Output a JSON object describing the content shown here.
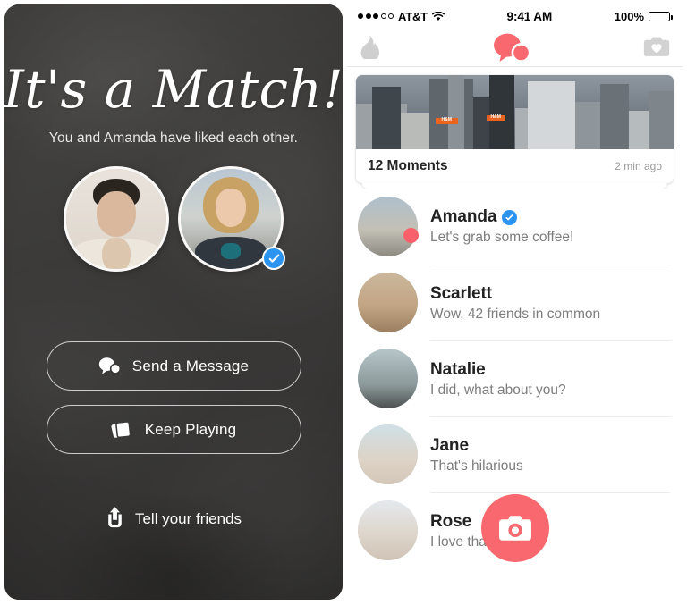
{
  "left_panel": {
    "title": "It's a Match!",
    "subtitle": "You and Amanda have liked each other.",
    "avatars": [
      {
        "name": "you-avatar",
        "verified": false
      },
      {
        "name": "amanda-avatar",
        "verified": true
      }
    ],
    "buttons": [
      {
        "label": "Send a Message",
        "icon": "chat-bubbles-icon"
      },
      {
        "label": "Keep Playing",
        "icon": "cards-stack-icon"
      }
    ],
    "share_label": "Tell your friends",
    "share_icon": "share-upload-icon"
  },
  "right_panel": {
    "status_bar": {
      "signal_dots_filled": 3,
      "signal_dots_total": 5,
      "carrier": "AT&T",
      "wifi": "wifi-icon",
      "time": "9:41 AM",
      "battery_percent": "100%"
    },
    "header": {
      "left_icon": "flame-icon",
      "center_icon": "chat-bubbles-icon",
      "right_icon": "camera-heart-icon"
    },
    "moments_card": {
      "label": "12 Moments",
      "time": "2 min ago",
      "photo_alt": "aerial-cityscape-photo",
      "signs": [
        "H&M",
        "H&M"
      ]
    },
    "matches": [
      {
        "name": "Amanda",
        "message": "Let's grab some coffee!",
        "verified": true,
        "unread": true,
        "avatar": "av-amanda"
      },
      {
        "name": "Scarlett",
        "message": "Wow, 42 friends in common",
        "verified": false,
        "unread": false,
        "avatar": "av-scarlett"
      },
      {
        "name": "Natalie",
        "message": "I did, what about you?",
        "verified": false,
        "unread": false,
        "avatar": "av-natalie"
      },
      {
        "name": "Jane",
        "message": "That's hilarious",
        "verified": false,
        "unread": false,
        "avatar": "av-jane"
      },
      {
        "name": "Rose",
        "message": "I love that Moment",
        "verified": false,
        "unread": false,
        "avatar": "av-rose"
      }
    ],
    "fab": {
      "icon": "camera-icon",
      "label": "New Moment"
    }
  },
  "colors": {
    "brand_coral": "#f8686e",
    "verified_blue": "#2b93f0",
    "dark_bg": "#3b3a39",
    "unread_dot": "#f8616b"
  }
}
